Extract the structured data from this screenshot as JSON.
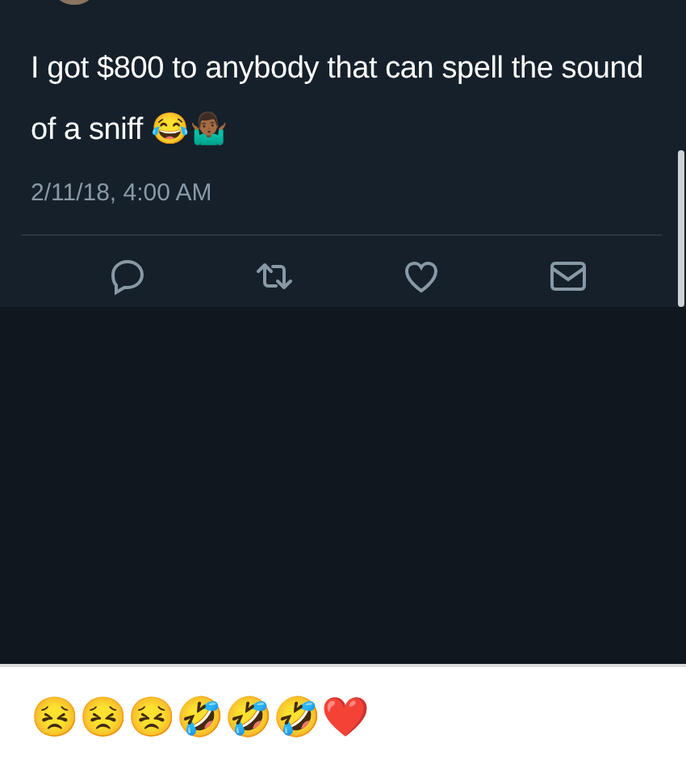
{
  "tweet": {
    "text": "I got $800 to anybody that can spell the sound of a sniff 😂🤷🏾‍♂️",
    "timestamp": "2/11/18, 4:00 AM"
  },
  "comment": {
    "text": "😣😣😣🤣🤣🤣❤️"
  }
}
